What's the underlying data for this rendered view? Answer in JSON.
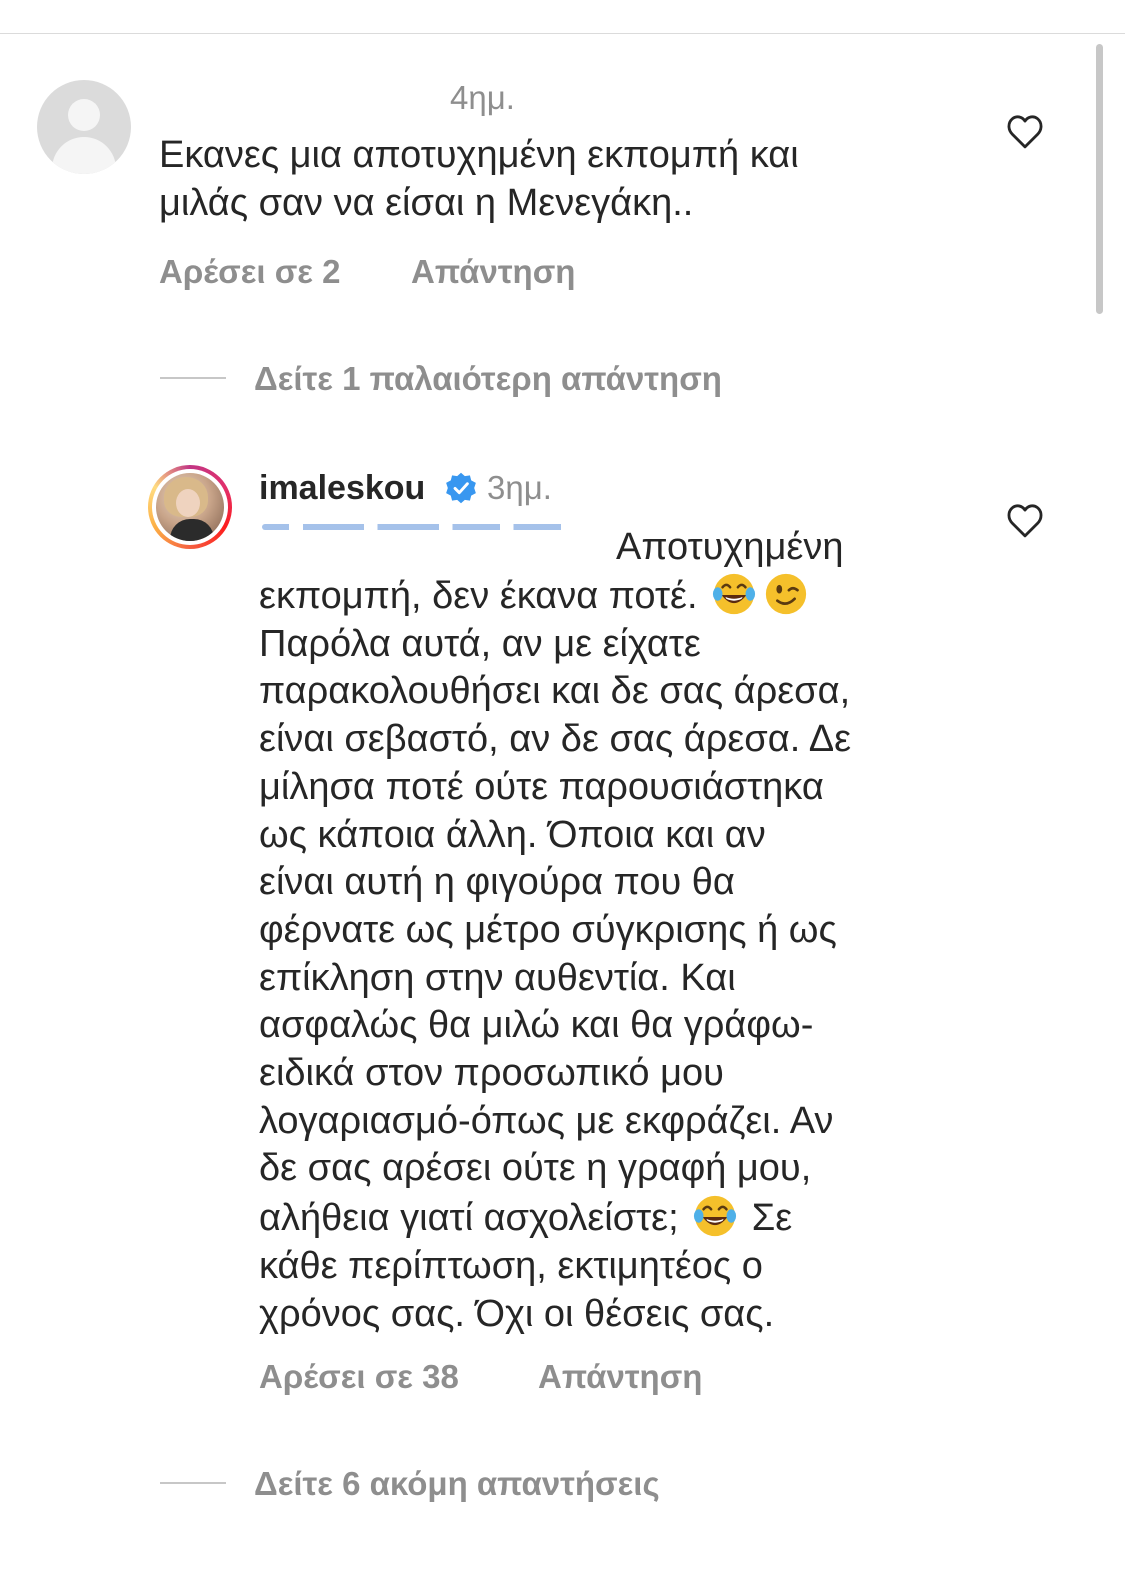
{
  "comments": [
    {
      "time": "4ημ.",
      "text": "Εκανες μια αποτυχημένη εκπομπή και\nμιλάς σαν να είσαι η Μενεγάκη..",
      "likes": "Αρέσει σε 2",
      "reply": "Απάντηση"
    },
    {
      "username": "imaleskou",
      "time": "3ημ.",
      "first_line": "Αποτυχημένη",
      "lines": [
        "εκπομπή, δεν έκανα ποτέ.",
        "Παρόλα αυτά, αν με είχατε",
        "παρακολουθήσει και δε σας άρεσα,",
        "είναι σεβαστό, αν δε σας άρεσα. Δε",
        "μίλησα ποτέ ούτε παρουσιάστηκα",
        "ως κάποια άλλη.  Όποια και αν",
        "είναι αυτή η φιγούρα που θα",
        "φέρνατε ως μέτρο σύγκρισης ή ως",
        "επίκληση στην αυθεντία. Και",
        "ασφαλώς θα μιλώ και θα γράφω-",
        "ειδικά στον προσωπικό μου",
        "λογαριασμό-όπως με εκφράζει. Αν",
        "δε σας αρέσει ούτε η γραφή μου,",
        "αλήθεια γιατί ασχολείστε;",
        "Σε",
        "κάθε περίπτωση, εκτιμητέος ο",
        "χρόνος σας. Όχι οι θέσεις σας."
      ],
      "likes": "Αρέσει σε 38",
      "reply": "Απάντηση"
    }
  ],
  "view_replies_1": "Δείτε 1 παλαιότερη απάντηση",
  "view_replies_2": "Δείτε 6 ακόμη απαντήσεις",
  "icons": {
    "heart": "heart-outline-icon",
    "verified": "verified-badge-icon",
    "emoji_laugh": "face-with-tears-of-joy",
    "emoji_wink": "winking-face"
  },
  "colors": {
    "text": "#262626",
    "secondary": "#8e8e8e",
    "verified": "#3897f0",
    "divider": "#c7c7c7"
  }
}
